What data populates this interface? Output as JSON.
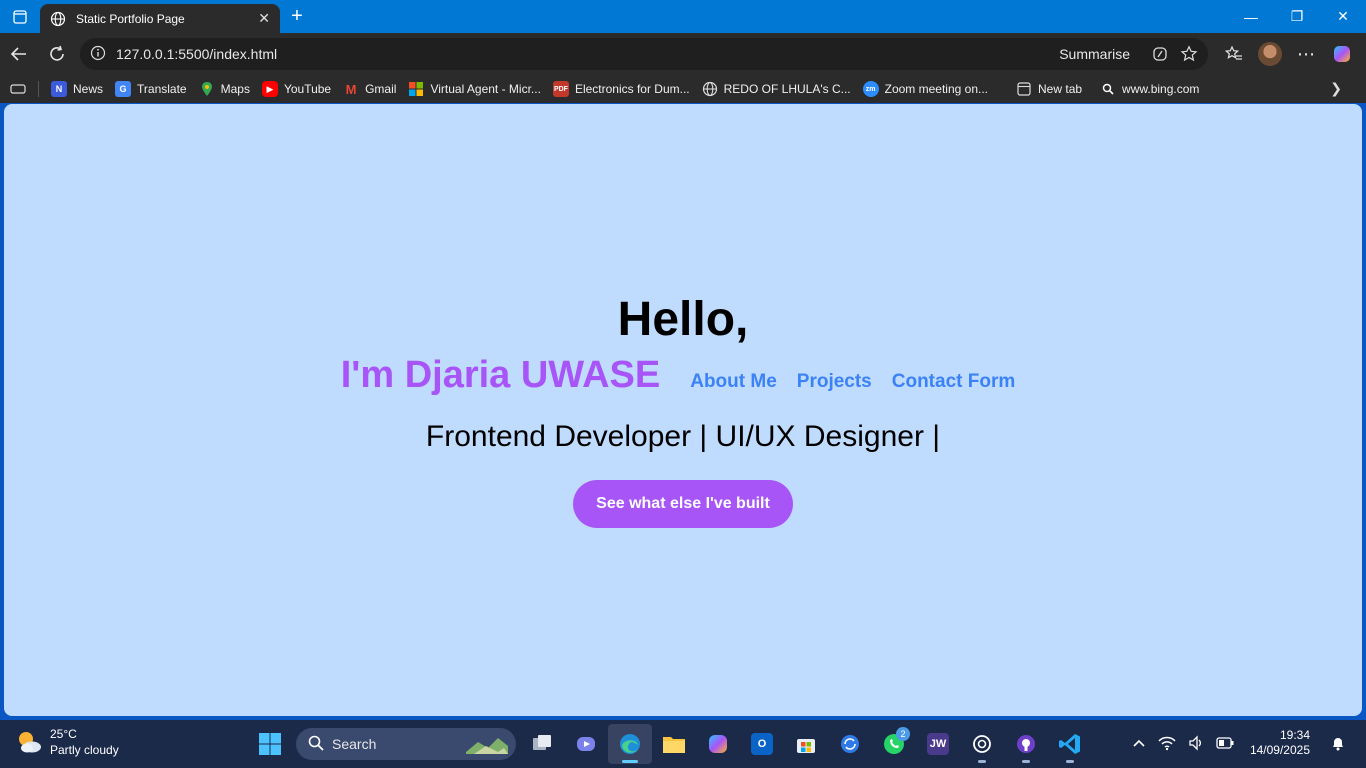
{
  "browser": {
    "tab_title": "Static Portfolio Page",
    "url": "127.0.0.1:5500/index.html",
    "summarise_label": "Summarise"
  },
  "favorites": [
    {
      "label": "News",
      "icon": "news-icon",
      "color": "#e74c3c"
    },
    {
      "label": "Translate",
      "icon": "translate-icon",
      "color": "#4285f4"
    },
    {
      "label": "Maps",
      "icon": "maps-icon",
      "color": "#34a853"
    },
    {
      "label": "YouTube",
      "icon": "youtube-icon",
      "color": "#ff0000"
    },
    {
      "label": "Gmail",
      "icon": "gmail-icon",
      "color": "#ea4335"
    },
    {
      "label": "Virtual Agent - Micr...",
      "icon": "microsoft-icon",
      "color": "#f25022"
    },
    {
      "label": "Electronics for Dum...",
      "icon": "pdf-icon",
      "color": "#c0392b"
    },
    {
      "label": "REDO OF LHULA's C...",
      "icon": "globe-icon",
      "color": "#555555"
    },
    {
      "label": "Zoom meeting on...",
      "icon": "zoom-icon",
      "color": "#2d8cff"
    },
    {
      "label": "New tab",
      "icon": "newtab-icon",
      "color": "#444444"
    },
    {
      "label": "www.bing.com",
      "icon": "search-icon",
      "color": "#333333"
    }
  ],
  "page": {
    "greeting": "Hello,",
    "name": "I'm Djaria UWASE",
    "nav": [
      "About Me",
      "Projects",
      "Contact Form"
    ],
    "role": "Frontend Developer | UI/UX Designer |",
    "cta": "See what else I've built"
  },
  "colors": {
    "page_bg": "#bfdbfe",
    "name_color": "#a855f7",
    "nav_color": "#3b82f6",
    "cta_bg": "#a855f7"
  },
  "taskbar": {
    "temperature": "25°C",
    "weather": "Partly cloudy",
    "search_label": "Search",
    "whatsapp_badge": "2",
    "time": "19:34",
    "date": "14/09/2025"
  }
}
